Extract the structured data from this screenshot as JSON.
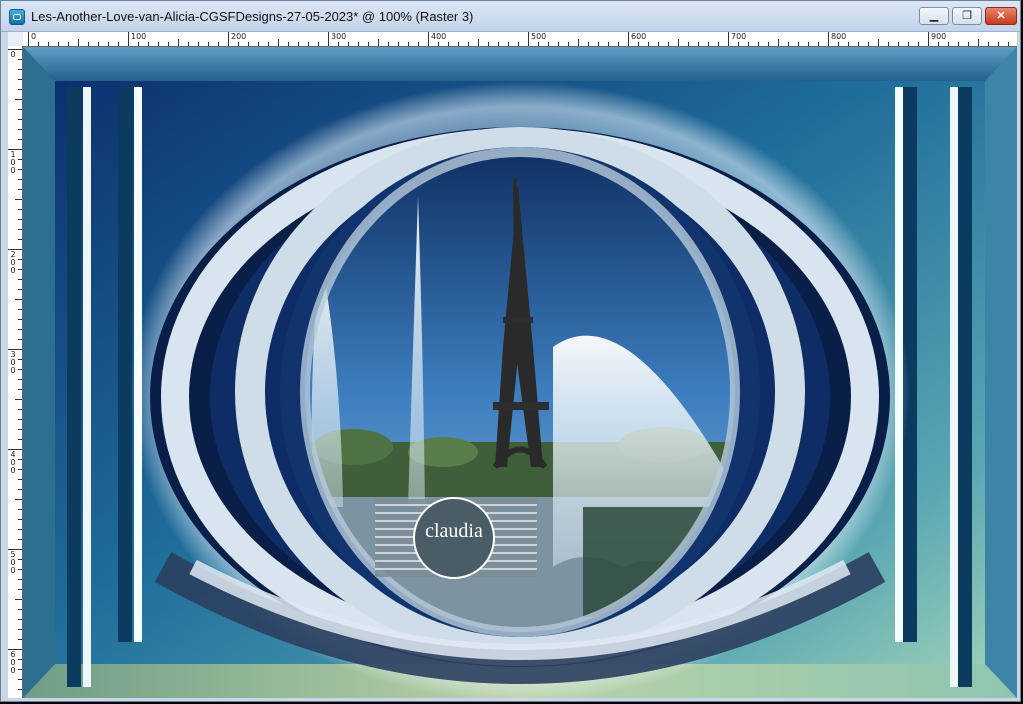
{
  "window": {
    "title": "Les-Another-Love-van-Alicia-CGSFDesigns-27-05-2023* @ 100% (Raster 3)",
    "buttons": {
      "minimize": "▁",
      "maximize": "❐",
      "close": "✕"
    }
  },
  "ruler": {
    "horizontal_labels": [
      "0",
      "100",
      "200",
      "300",
      "400",
      "500",
      "600",
      "700",
      "800",
      "900"
    ],
    "vertical_labels": [
      "0",
      "100",
      "200",
      "300",
      "400",
      "500",
      "600"
    ]
  },
  "canvas": {
    "zoom": "100%",
    "layer": "Raster 3",
    "watermark_text": "claudia",
    "colors": {
      "deep_blue": "#0a2a6a",
      "frame_blue": "#1b5d86",
      "ring_white": "#d8e4ef",
      "sea_green": "#9ccbb0"
    }
  }
}
